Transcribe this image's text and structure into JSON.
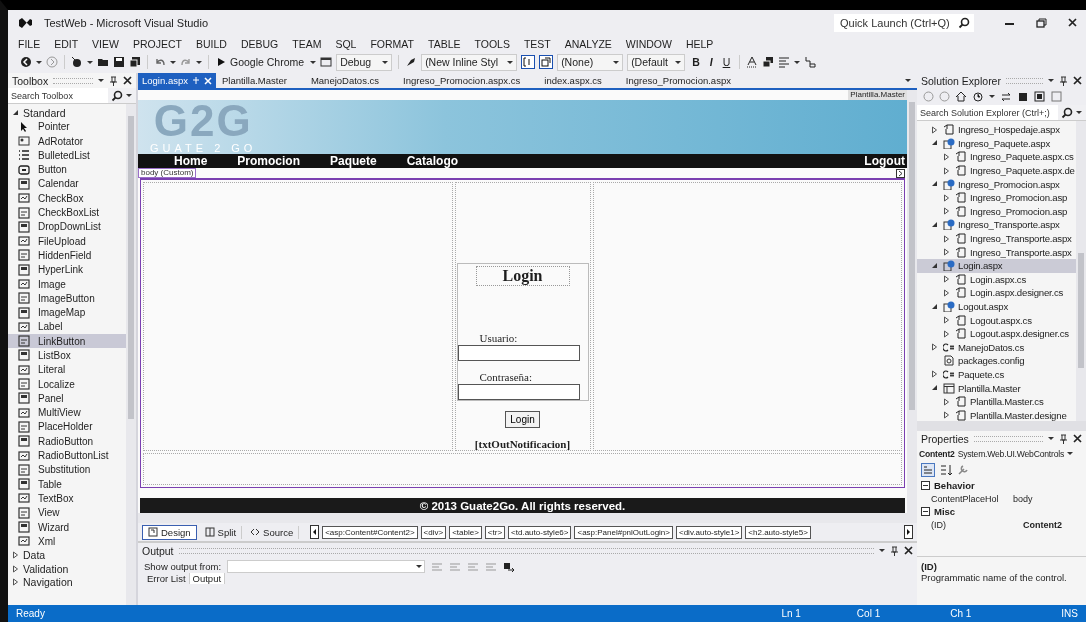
{
  "window": {
    "title": "TestWeb - Microsoft Visual Studio",
    "quick_launch": {
      "placeholder": "Quick Launch (Ctrl+Q)"
    }
  },
  "menu": [
    "FILE",
    "EDIT",
    "VIEW",
    "PROJECT",
    "BUILD",
    "DEBUG",
    "TEAM",
    "SQL",
    "FORMAT",
    "TABLE",
    "TOOLS",
    "TEST",
    "ANALYZE",
    "WINDOW",
    "HELP"
  ],
  "toolbar": {
    "run_target": "Google Chrome",
    "configuration": "Debug",
    "style": "(New Inline Styl",
    "target_rule": "(None)",
    "font": "(Default",
    "format_buttons": [
      "B",
      "I",
      "U"
    ]
  },
  "toolbox": {
    "title": "Toolbox",
    "search": {
      "placeholder": "Search Toolbox"
    },
    "groups": [
      {
        "label": "Standard",
        "expanded": true,
        "items": [
          {
            "label": "Pointer",
            "selected": false
          },
          {
            "label": "AdRotator",
            "selected": false
          },
          {
            "label": "BulletedList",
            "selected": false
          },
          {
            "label": "Button",
            "selected": false
          },
          {
            "label": "Calendar",
            "selected": false
          },
          {
            "label": "CheckBox",
            "selected": false
          },
          {
            "label": "CheckBoxList",
            "selected": false
          },
          {
            "label": "DropDownList",
            "selected": false
          },
          {
            "label": "FileUpload",
            "selected": false
          },
          {
            "label": "HiddenField",
            "selected": false
          },
          {
            "label": "HyperLink",
            "selected": false
          },
          {
            "label": "Image",
            "selected": false
          },
          {
            "label": "ImageButton",
            "selected": false
          },
          {
            "label": "ImageMap",
            "selected": false
          },
          {
            "label": "Label",
            "selected": false
          },
          {
            "label": "LinkButton",
            "selected": true
          },
          {
            "label": "ListBox",
            "selected": false
          },
          {
            "label": "Literal",
            "selected": false
          },
          {
            "label": "Localize",
            "selected": false
          },
          {
            "label": "Panel",
            "selected": false
          },
          {
            "label": "MultiView",
            "selected": false
          },
          {
            "label": "PlaceHolder",
            "selected": false
          },
          {
            "label": "RadioButton",
            "selected": false
          },
          {
            "label": "RadioButtonList",
            "selected": false
          },
          {
            "label": "Substitution",
            "selected": false
          },
          {
            "label": "Table",
            "selected": false
          },
          {
            "label": "TextBox",
            "selected": false
          },
          {
            "label": "View",
            "selected": false
          },
          {
            "label": "Wizard",
            "selected": false
          },
          {
            "label": "Xml",
            "selected": false
          }
        ]
      },
      {
        "label": "Data",
        "expanded": false
      },
      {
        "label": "Validation",
        "expanded": false
      },
      {
        "label": "Navigation",
        "expanded": false
      }
    ]
  },
  "document_tabs": [
    {
      "label": "Login.aspx",
      "selected": true
    },
    {
      "label": "Plantilla.Master",
      "selected": false
    },
    {
      "label": "ManejoDatos.cs",
      "selected": false
    },
    {
      "label": "Ingreso_Promocion.aspx.cs",
      "selected": false
    },
    {
      "label": "index.aspx.cs",
      "selected": false
    },
    {
      "label": "Ingreso_Promocion.aspx",
      "selected": false
    }
  ],
  "designer": {
    "master_label": "Plantilla.Master",
    "logo": {
      "title": "G2G",
      "subtitle": "GUATE 2 GO"
    },
    "nav": [
      "Home",
      "Promocion",
      "Paquete",
      "Catalogo"
    ],
    "nav_right": "Logout",
    "body_tag": "body (Custom)",
    "login": {
      "heading": "Login",
      "username_label": "Usuario:",
      "password_label": "Contraseña:",
      "button": "Login",
      "notification": "[txtOutNotificacion]"
    },
    "footer": "© 2013 Guate2Go. All rights reserved."
  },
  "view_tabs": [
    {
      "label": "Design",
      "selected": true
    },
    {
      "label": "Split",
      "selected": false
    },
    {
      "label": "Source",
      "selected": false
    }
  ],
  "tag_path": [
    "<asp:Content#Content2>",
    "<div>",
    "<table>",
    "<tr>",
    "<td.auto-style6>",
    "<asp:Panel#pnlOutLogin>",
    "<div.auto-style1>",
    "<h2.auto-style5>"
  ],
  "output": {
    "title": "Output",
    "show_from_label": "Show output from:",
    "tabs": [
      {
        "label": "Error List",
        "selected": false
      },
      {
        "label": "Output",
        "selected": true
      }
    ]
  },
  "solution_explorer": {
    "title": "Solution Explorer",
    "search": {
      "placeholder": "Search Solution Explorer (Ctrl+;)"
    },
    "items": [
      {
        "label": "Ingreso_Hospedaje.aspx",
        "kind": "code",
        "expanded": false,
        "selected": false
      },
      {
        "label": "Ingreso_Paquete.aspx",
        "kind": "page",
        "expanded": true,
        "selected": false,
        "children": [
          {
            "label": "Ingreso_Paquete.aspx.cs",
            "kind": "code",
            "expanded": false,
            "selected": false
          },
          {
            "label": "Ingreso_Paquete.aspx.de",
            "kind": "code",
            "expanded": false,
            "selected": false
          }
        ]
      },
      {
        "label": "Ingreso_Promocion.aspx",
        "kind": "page",
        "expanded": true,
        "selected": false,
        "children": [
          {
            "label": "Ingreso_Promocion.asp",
            "kind": "code",
            "expanded": false,
            "selected": false
          },
          {
            "label": "Ingreso_Promocion.asp",
            "kind": "code",
            "expanded": false,
            "selected": false
          }
        ]
      },
      {
        "label": "Ingreso_Transporte.aspx",
        "kind": "page",
        "expanded": true,
        "selected": false,
        "children": [
          {
            "label": "Ingreso_Transporte.aspx",
            "kind": "code",
            "expanded": false,
            "selected": false
          },
          {
            "label": "Ingreso_Transporte.aspx",
            "kind": "code",
            "expanded": false,
            "selected": false
          }
        ]
      },
      {
        "label": "Login.aspx",
        "kind": "page",
        "expanded": true,
        "selected": true,
        "children": [
          {
            "label": "Login.aspx.cs",
            "kind": "code",
            "expanded": false,
            "selected": false
          },
          {
            "label": "Login.aspx.designer.cs",
            "kind": "code",
            "expanded": false,
            "selected": false
          }
        ]
      },
      {
        "label": "Logout.aspx",
        "kind": "page",
        "expanded": true,
        "selected": false,
        "children": [
          {
            "label": "Logout.aspx.cs",
            "kind": "code",
            "expanded": false,
            "selected": false
          },
          {
            "label": "Logout.aspx.designer.cs",
            "kind": "code",
            "expanded": false,
            "selected": false
          }
        ]
      },
      {
        "label": "ManejoDatos.cs",
        "kind": "csharp",
        "expanded": false,
        "selected": false
      },
      {
        "label": "packages.config",
        "kind": "config",
        "selected": false
      },
      {
        "label": "Paquete.cs",
        "kind": "csharp",
        "expanded": false,
        "selected": false
      },
      {
        "label": "Plantilla.Master",
        "kind": "master",
        "expanded": true,
        "selected": false,
        "children": [
          {
            "label": "Plantilla.Master.cs",
            "kind": "code",
            "expanded": false,
            "selected": false
          },
          {
            "label": "Plantilla.Master.designe",
            "kind": "code",
            "expanded": false,
            "selected": false
          }
        ]
      }
    ]
  },
  "properties": {
    "title": "Properties",
    "object": "Content2",
    "type": "System.Web.UI.WebControls",
    "categories": [
      {
        "label": "Behavior",
        "expanded": true,
        "rows": [
          {
            "name": "ContentPlaceHol",
            "value": "body",
            "bold": false
          }
        ]
      },
      {
        "label": "Misc",
        "expanded": true,
        "rows": [
          {
            "name": "(ID)",
            "value": "Content2",
            "bold": true
          }
        ]
      }
    ],
    "description": {
      "title": "(ID)",
      "text": "Programmatic name of the control."
    }
  },
  "status_bar": {
    "message": "Ready",
    "line": "Ln 1",
    "column": "Col 1",
    "char": "Ch 1",
    "mode": "INS"
  }
}
